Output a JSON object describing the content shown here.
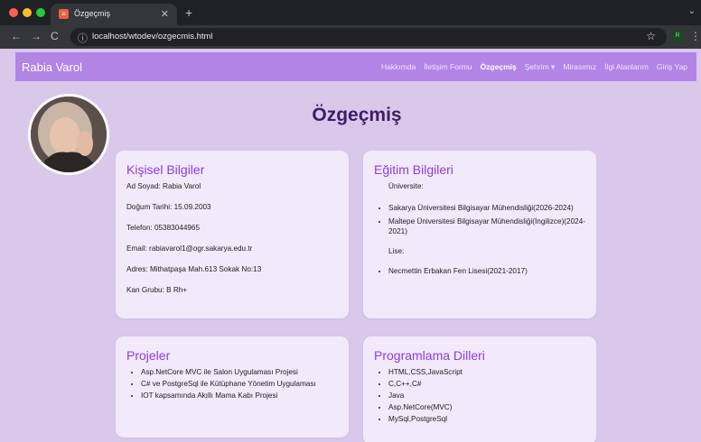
{
  "browser": {
    "tab_title": "Özgeçmiş",
    "tab_favicon": "≡",
    "url": "localhost/wtodev/ozgecmis.html",
    "profile_initial": "R"
  },
  "navbar": {
    "brand": "Rabia Varol",
    "links": [
      "Hakkımda",
      "İletişim Formu",
      "Özgeçmiş",
      "Şehrim ▾",
      "Mirasımız",
      "İlgi Alanlarım",
      "Giriş Yap"
    ],
    "active_index": 2
  },
  "page_title": "Özgeçmiş",
  "personal": {
    "title": "Kişisel Bilgiler",
    "lines": [
      "Ad Soyad: Rabia Varol",
      "Doğum Tarihi: 15.09.2003",
      "Telefon: 05383044965",
      "Email: rabiavarol1@ogr.sakarya.edu.tr",
      "Adres: Mithatpaşa Mah.613 Sokak No:13",
      "Kan Grubu: B Rh+"
    ]
  },
  "education": {
    "title": "Eğitim Bilgileri",
    "university_label": "Üniversite:",
    "universities": [
      "Sakarya Üniversitesi Bilgisayar Mühendisliği(2026-2024)",
      "Maltepe Üniversitesi Bilgisayar Mühendisliği(İngilizce)(2024-2021)"
    ],
    "highschool_label": "Lise:",
    "highschools": [
      "Necmettin Erbakan Fen Lisesi(2021-2017)"
    ]
  },
  "projects": {
    "title": "Projeler",
    "items": [
      "Asp.NetCore MVC ile Salon Uygulaması Projesi",
      "C# ve PostgreSql ile Kütüphane Yönetim Uygulaması",
      "IOT kapsamında Akıllı Mama Kabı Projesi"
    ]
  },
  "languages": {
    "title": "Programlama Dilleri",
    "items": [
      "HTML,CSS,JavaScript",
      "C,C++,C#",
      "Java",
      "Asp.NetCore(MVC)",
      "MySql,PostgreSql"
    ]
  }
}
